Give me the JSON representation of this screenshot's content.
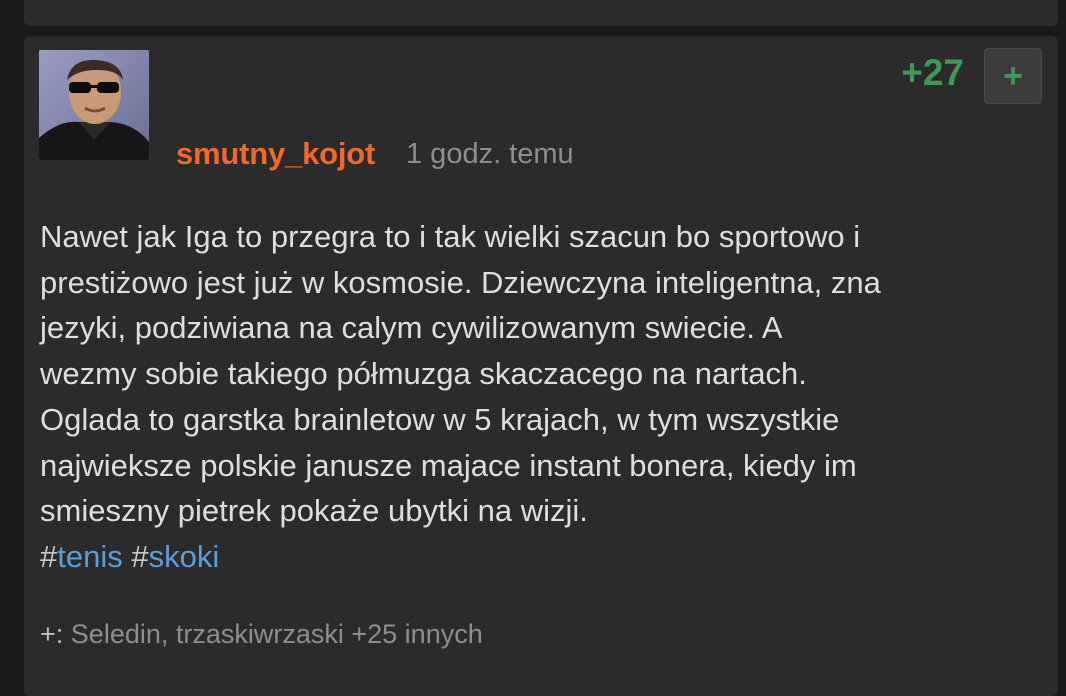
{
  "entry": {
    "author": "smutny_kojot",
    "timestamp": "1 godz. temu",
    "score": "+27",
    "plus_label": "+",
    "body_lines": [
      "Nawet jak Iga to przegra to i tak wielki szacun bo sportowo i",
      "prestiżowo jest już w kosmosie. Dziewczyna inteligentna, zna",
      "jezyki, podziwiana na calym cywilizowanym swiecie. A",
      "wezmy sobie takiego półmuzga skaczacego na nartach.",
      "Oglada to garstka brainletow w 5 krajach, w tym wszystkie",
      "najwieksze polskie janusze majace instant bonera, kiedy im",
      "smieszny pietrek pokaże ubytki na wizji."
    ],
    "tags": [
      {
        "hash": "#",
        "name": "tenis"
      },
      {
        "hash": "#",
        "name": "skoki"
      }
    ],
    "voters_prefix": "+:",
    "voters_text": "Seledin, trzaskiwrzaski +25 innych"
  },
  "colors": {
    "background": "#1a1a1a",
    "card": "#2b2b2b",
    "author": "#f2682a",
    "score": "#3f9956",
    "tag": "#5d9dd6",
    "text": "#dedede",
    "muted": "#8e8e8e"
  },
  "icons": {
    "avatar": "user-avatar-photo"
  }
}
